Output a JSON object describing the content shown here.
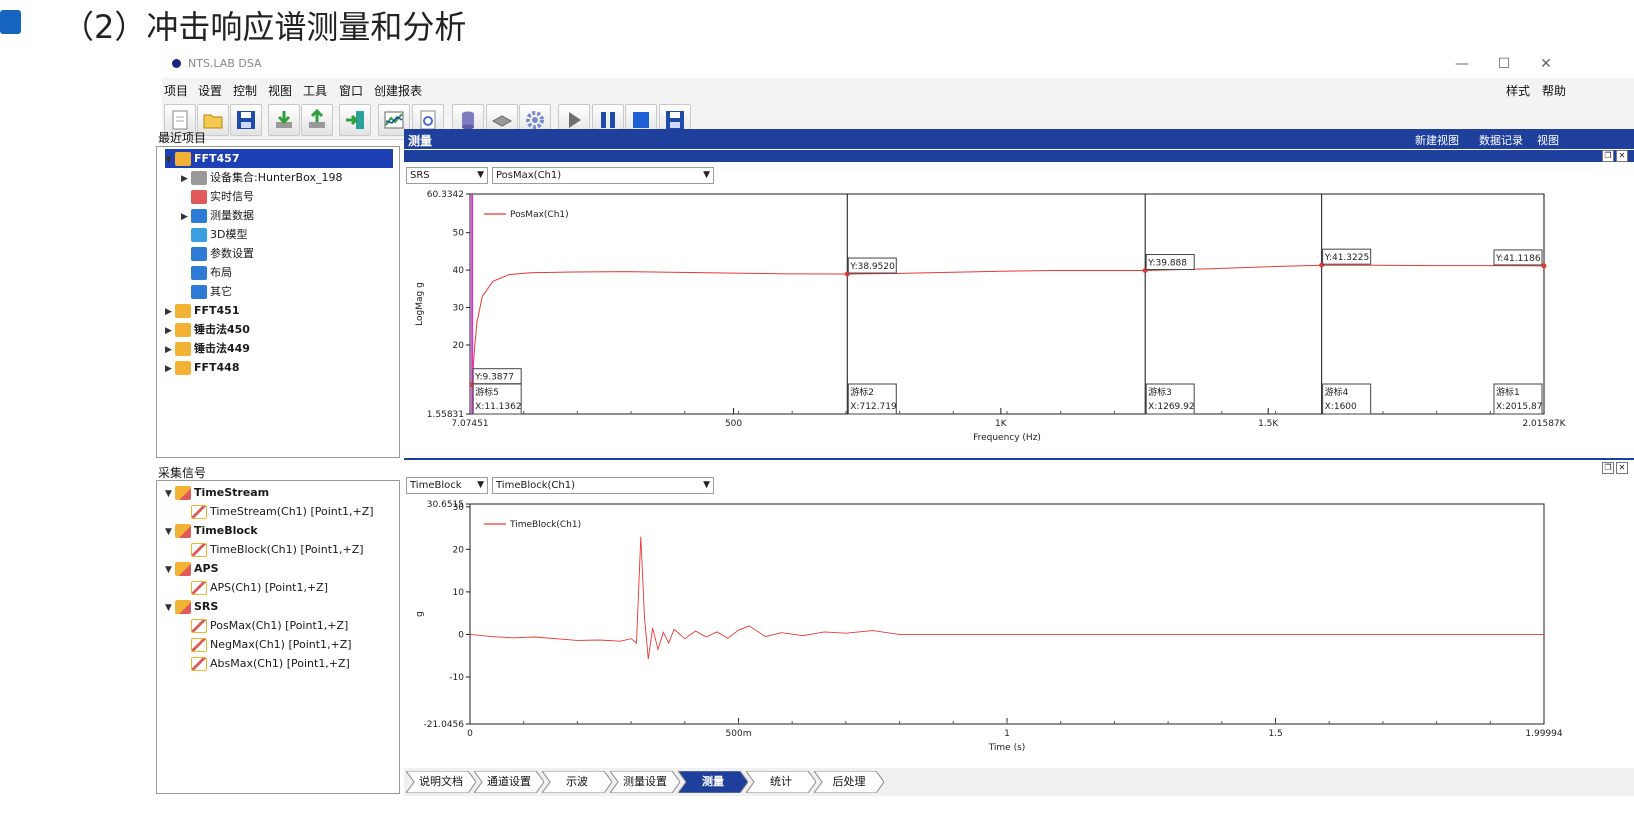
{
  "slide": {
    "title": "（2）冲击响应谱测量和分析"
  },
  "app": {
    "title": "NTS.LAB DSA",
    "window_controls": {
      "minimize": "—",
      "maximize": "☐",
      "close": "✕"
    }
  },
  "menu": {
    "items": [
      "项目",
      "设置",
      "控制",
      "视图",
      "工具",
      "窗口",
      "创建报表"
    ],
    "right": [
      "样式",
      "帮助"
    ]
  },
  "toolbar": {
    "buttons": [
      "new-icon",
      "open-folder-icon",
      "save-icon",
      "import-icon",
      "export-icon",
      "exit-icon",
      "chart-icon",
      "settings-doc-icon",
      "database-icon",
      "device-icon",
      "gear-icon",
      "play-icon",
      "pause-icon",
      "stop-icon",
      "save-data-icon"
    ]
  },
  "recent": {
    "heading": "最近项目",
    "items": [
      {
        "label": "FFT457",
        "level": 0,
        "expanded": true,
        "selected": true,
        "bold": true,
        "icon": "project-icon"
      },
      {
        "label": "设备集合:HunterBox_198",
        "level": 1,
        "expandable": true,
        "icon": "device-icon"
      },
      {
        "label": "实时信号",
        "level": 1,
        "icon": "signal-icon"
      },
      {
        "label": "测量数据",
        "level": 1,
        "expandable": true,
        "icon": "tools-icon"
      },
      {
        "label": "3D模型",
        "level": 1,
        "icon": "model-icon"
      },
      {
        "label": "参数设置",
        "level": 1,
        "icon": "gear-icon"
      },
      {
        "label": "布局",
        "level": 1,
        "icon": "grid-icon"
      },
      {
        "label": "其它",
        "level": 1,
        "icon": "list-icon"
      },
      {
        "label": "FFT451",
        "level": 0,
        "expandable": true,
        "bold": true,
        "icon": "project-icon"
      },
      {
        "label": "锤击法450",
        "level": 0,
        "expandable": true,
        "bold": true,
        "icon": "project-icon"
      },
      {
        "label": "锤击法449",
        "level": 0,
        "expandable": true,
        "bold": true,
        "icon": "project-icon"
      },
      {
        "label": "FFT448",
        "level": 0,
        "expandable": true,
        "bold": true,
        "icon": "project-icon"
      }
    ]
  },
  "signals": {
    "heading": "采集信号",
    "items": [
      {
        "label": "TimeStream",
        "level": 0,
        "bold": true
      },
      {
        "label": "TimeStream(Ch1) [Point1,+Z]",
        "level": 1
      },
      {
        "label": "TimeBlock",
        "level": 0,
        "bold": true
      },
      {
        "label": "TimeBlock(Ch1) [Point1,+Z]",
        "level": 1
      },
      {
        "label": "APS",
        "level": 0,
        "bold": true
      },
      {
        "label": "APS(Ch1) [Point1,+Z]",
        "level": 1
      },
      {
        "label": "SRS",
        "level": 0,
        "bold": true
      },
      {
        "label": "PosMax(Ch1) [Point1,+Z]",
        "level": 1
      },
      {
        "label": "NegMax(Ch1) [Point1,+Z]",
        "level": 1
      },
      {
        "label": "AbsMax(Ch1) [Point1,+Z]",
        "level": 1
      }
    ]
  },
  "measure": {
    "title": "测量",
    "right_menu": [
      "新建视图",
      "数据记录",
      "视图"
    ]
  },
  "chart_data": [
    {
      "type": "line",
      "combo_type": "SRS",
      "combo_signal": "PosMax(Ch1)",
      "xlabel": "Frequency (Hz)",
      "ylabel": "LogMag g",
      "xlim": [
        7.07451,
        2015.87
      ],
      "ylim": [
        1.55831,
        60.3342
      ],
      "xticks": [
        "7.07451",
        "500",
        "1K",
        "1.5K",
        "2.01587K"
      ],
      "yticks": [
        "60.3342",
        "50",
        "40",
        "30",
        "20",
        "1.55831"
      ],
      "series": [
        {
          "name": "PosMax(Ch1)",
          "color": "#e53935",
          "x": [
            11.1362,
            15,
            20,
            30,
            50,
            80,
            120,
            200,
            300,
            400,
            500,
            600,
            712.719,
            800,
            900,
            1000,
            1100,
            1200,
            1269.92,
            1400,
            1500,
            1600,
            1700,
            1800,
            1900,
            2015.87
          ],
          "y": [
            9.3877,
            18,
            26,
            33,
            37,
            38.8,
            39.3,
            39.5,
            39.6,
            39.4,
            39.2,
            39.0,
            38.95,
            39.1,
            39.4,
            39.7,
            39.9,
            39.9,
            39.888,
            40.4,
            40.9,
            41.32,
            41.3,
            41.2,
            41.2,
            41.12
          ]
        }
      ],
      "cursors": [
        {
          "label": "游标5",
          "x": "X:11.1362",
          "y": "Y:9.3877",
          "xv": 11.1362,
          "yv": 9.3877,
          "color": "#d633d6"
        },
        {
          "label": "游标2",
          "x": "X:712.719",
          "y": "Y:38.9520",
          "xv": 712.719,
          "yv": 38.952,
          "color": "#111111"
        },
        {
          "label": "游标3",
          "x": "X:1269.92",
          "y": "Y:39.888",
          "xv": 1269.92,
          "yv": 39.888,
          "color": "#111111"
        },
        {
          "label": "游标4",
          "x": "X:1600",
          "y": "Y:41.3225",
          "xv": 1600,
          "yv": 41.3225,
          "color": "#111111"
        },
        {
          "label": "游标1",
          "x": "X:2015.87",
          "y": "Y:41.1186",
          "xv": 2015.87,
          "yv": 41.1186,
          "color": "#111111"
        }
      ]
    },
    {
      "type": "line",
      "combo_type": "TimeBlock",
      "combo_signal": "TimeBlock(Ch1)",
      "xlabel": "Time (s)",
      "ylabel": "g",
      "xlim": [
        0,
        1.99994
      ],
      "ylim": [
        -21.0456,
        30.6515
      ],
      "xticks": [
        "0",
        "500m",
        "1",
        "1.5",
        "1.99994"
      ],
      "yticks": [
        "30.6515",
        "30",
        "20",
        "10",
        "0",
        "-10",
        "-21.0456"
      ],
      "series": [
        {
          "name": "TimeBlock(Ch1)",
          "color": "#e53935",
          "x": [
            0,
            0.04,
            0.08,
            0.12,
            0.16,
            0.2,
            0.24,
            0.28,
            0.3,
            0.31,
            0.318,
            0.325,
            0.332,
            0.34,
            0.35,
            0.36,
            0.37,
            0.38,
            0.4,
            0.42,
            0.44,
            0.46,
            0.48,
            0.5,
            0.52,
            0.55,
            0.58,
            0.62,
            0.66,
            0.7,
            0.75,
            0.8,
            1.0,
            1.5,
            1.99994
          ],
          "y": [
            0,
            -0.5,
            -0.8,
            -0.6,
            -1.0,
            -1.4,
            -1.3,
            -1.6,
            -1.0,
            -2.0,
            23.0,
            4.0,
            -5.8,
            1.5,
            -3.5,
            0.5,
            -2.0,
            1.2,
            -1.0,
            0.8,
            -0.6,
            0.6,
            -0.9,
            1.0,
            2.0,
            -0.5,
            0.4,
            -0.3,
            0.6,
            0.3,
            0.9,
            0,
            0,
            0,
            0
          ]
        }
      ]
    }
  ],
  "workflow": {
    "tabs": [
      "说明文档",
      "通道设置",
      "示波",
      "测量设置",
      "测量",
      "统计",
      "后处理"
    ],
    "active": "测量"
  }
}
